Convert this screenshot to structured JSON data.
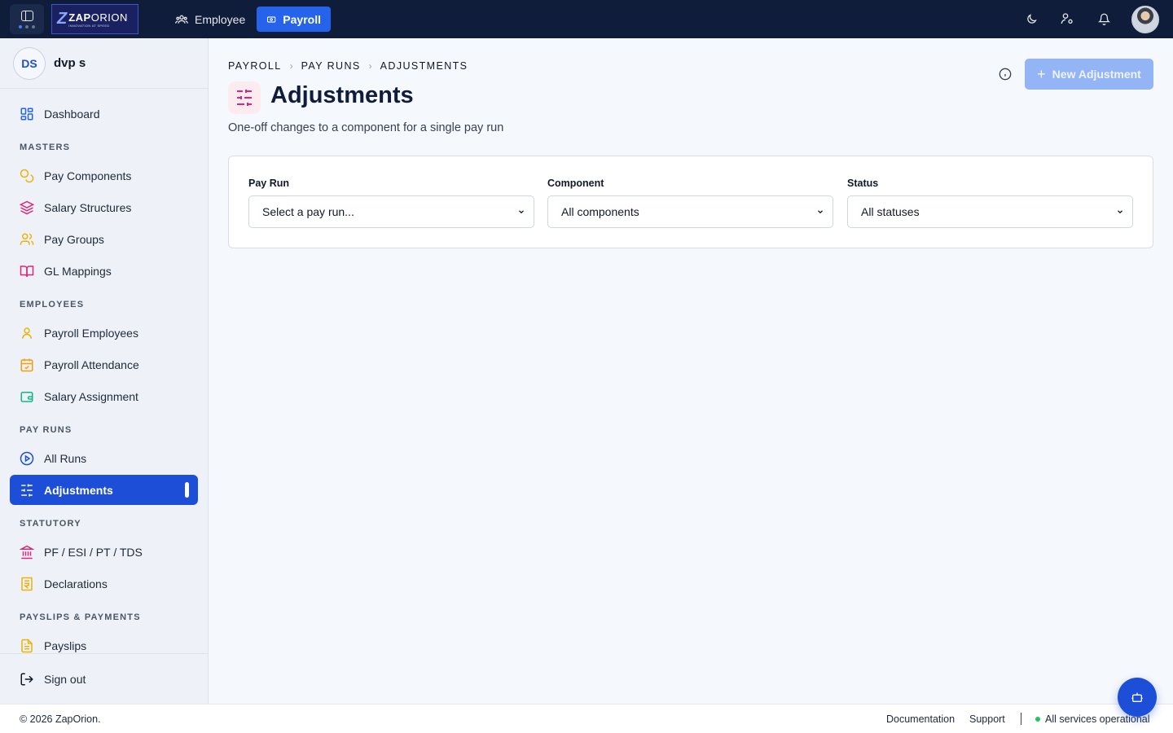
{
  "topbar": {
    "logo": {
      "mark": "Z",
      "name_bold": "ZAP",
      "name_rest": "ORION",
      "tagline": "INNOVATION AT SPEED"
    },
    "nav": [
      {
        "label": "Employee",
        "icon": "users-icon",
        "active": false
      },
      {
        "label": "Payroll",
        "icon": "banknote-icon",
        "active": true
      }
    ],
    "icons": [
      "moon-icon",
      "user-cog-icon",
      "bell-icon"
    ]
  },
  "user": {
    "initials": "DS",
    "name": "dvp s"
  },
  "sidebar": {
    "dashboard": {
      "label": "Dashboard",
      "icon": "layout-grid-icon"
    },
    "sections": {
      "masters": "MASTERS",
      "employees": "EMPLOYEES",
      "pay_runs": "PAY RUNS",
      "statutory": "STATUTORY",
      "payslips": "PAYSLIPS & PAYMENTS"
    },
    "items": {
      "pay_components": "Pay Components",
      "salary_structures": "Salary Structures",
      "pay_groups": "Pay Groups",
      "gl_mappings": "GL Mappings",
      "payroll_employees": "Payroll Employees",
      "payroll_attendance": "Payroll Attendance",
      "salary_assignment": "Salary Assignment",
      "all_runs": "All Runs",
      "adjustments": "Adjustments",
      "pf_esi": "PF / ESI / PT / TDS",
      "declarations": "Declarations",
      "payslips": "Payslips"
    },
    "sign_out": "Sign out"
  },
  "breadcrumb": [
    "PAYROLL",
    "PAY RUNS",
    "ADJUSTMENTS"
  ],
  "page": {
    "title": "Adjustments",
    "subtitle": "One-off changes to a component for a single pay run",
    "new_button": "New Adjustment"
  },
  "filters": {
    "pay_run": {
      "label": "Pay Run",
      "value": "Select a pay run..."
    },
    "component": {
      "label": "Component",
      "value": "All components"
    },
    "status": {
      "label": "Status",
      "value": "All statuses"
    }
  },
  "footer": {
    "copyright": "© 2026 ZapOrion.",
    "documentation": "Documentation",
    "support": "Support",
    "status": "All services operational"
  },
  "colors": {
    "topbar_bg": "#0f1d3a",
    "accent": "#1d4ed8",
    "status_ok": "#22c55e"
  }
}
